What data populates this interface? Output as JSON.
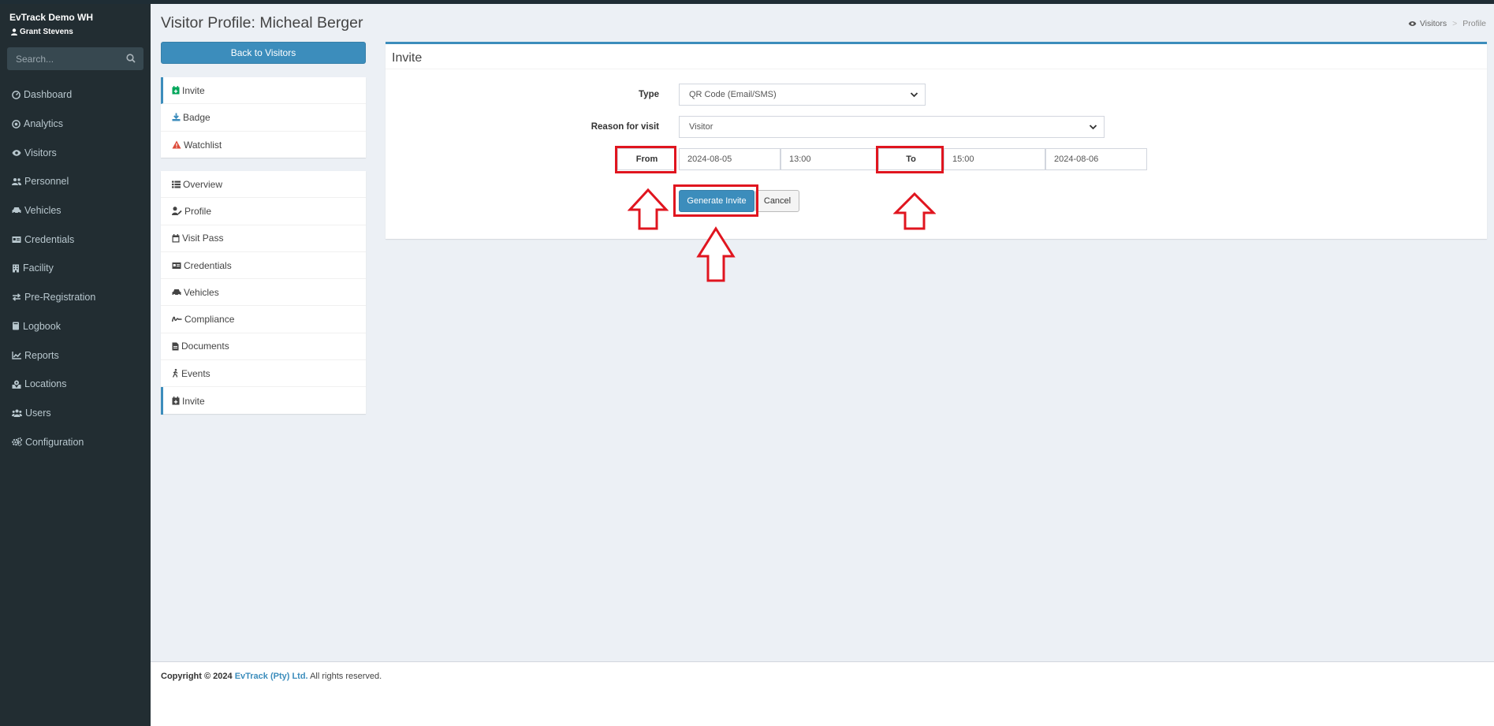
{
  "app": {
    "brand": "EvTrack Demo WH",
    "user": "Grant Stevens"
  },
  "search": {
    "placeholder": "Search..."
  },
  "nav": [
    {
      "label": "Dashboard",
      "icon": "dashboard-icon"
    },
    {
      "label": "Analytics",
      "icon": "analytics-icon"
    },
    {
      "label": "Visitors",
      "icon": "eye-icon"
    },
    {
      "label": "Personnel",
      "icon": "users-icon"
    },
    {
      "label": "Vehicles",
      "icon": "car-icon"
    },
    {
      "label": "Credentials",
      "icon": "id-card-icon"
    },
    {
      "label": "Facility",
      "icon": "building-icon"
    },
    {
      "label": "Pre-Registration",
      "icon": "exchange-icon"
    },
    {
      "label": "Logbook",
      "icon": "book-icon"
    },
    {
      "label": "Reports",
      "icon": "chart-icon"
    },
    {
      "label": "Locations",
      "icon": "map-icon"
    },
    {
      "label": "Users",
      "icon": "users-group-icon"
    },
    {
      "label": "Configuration",
      "icon": "cogs-icon"
    }
  ],
  "page": {
    "title": "Visitor Profile: Micheal Berger"
  },
  "breadcrumb": {
    "visitors": "Visitors",
    "current": "Profile"
  },
  "back_label": "Back to Visitors",
  "actions": [
    {
      "label": "Invite",
      "icon": "calendar-plus-icon",
      "color": "#00a65a"
    },
    {
      "label": "Badge",
      "icon": "download-icon",
      "color": "#3c8dbc"
    },
    {
      "label": "Watchlist",
      "icon": "warning-icon",
      "color": "#dd4b39"
    }
  ],
  "profile_menu": [
    {
      "label": "Overview",
      "icon": "list-icon"
    },
    {
      "label": "Profile",
      "icon": "user-edit-icon"
    },
    {
      "label": "Visit Pass",
      "icon": "calendar-icon"
    },
    {
      "label": "Credentials",
      "icon": "id-card-icon"
    },
    {
      "label": "Vehicles",
      "icon": "car-icon"
    },
    {
      "label": "Compliance",
      "icon": "signature-icon"
    },
    {
      "label": "Documents",
      "icon": "file-icon"
    },
    {
      "label": "Events",
      "icon": "walking-icon"
    },
    {
      "label": "Invite",
      "icon": "calendar-plus-icon"
    }
  ],
  "invite": {
    "title": "Invite",
    "type_label": "Type",
    "type_value": "QR Code (Email/SMS)",
    "reason_label": "Reason for visit",
    "reason_value": "Visitor",
    "from_label": "From",
    "from_date": "2024-08-05",
    "from_time": "13:00",
    "to_label": "To",
    "to_time": "15:00",
    "to_date": "2024-08-06",
    "generate_label": "Generate Invite",
    "cancel_label": "Cancel"
  },
  "footer": {
    "prefix": "Copyright © 2024",
    "company": "EvTrack (Pty) Ltd.",
    "suffix": "All rights reserved."
  },
  "colors": {
    "sidebar": "#222d32",
    "accent": "#3c8dbc",
    "highlight": "#e0151f",
    "success": "#00a65a",
    "danger": "#dd4b39"
  }
}
